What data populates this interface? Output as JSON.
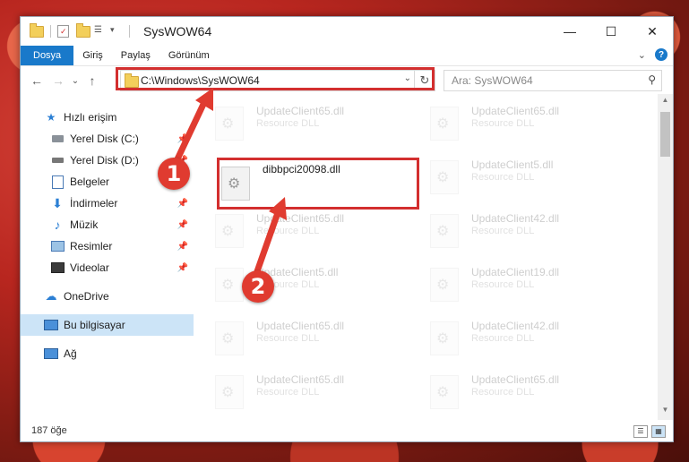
{
  "window": {
    "title": "SysWOW64"
  },
  "window_controls": {
    "minimize": "—",
    "maximize": "☐",
    "close": "✕"
  },
  "ribbon": {
    "tabs": [
      "Dosya",
      "Giriş",
      "Paylaş",
      "Görünüm"
    ],
    "expand": "⌄",
    "help": "?"
  },
  "nav": {
    "back": "←",
    "forward": "→",
    "recent": "⌄",
    "up": "↑",
    "address": "C:\\Windows\\SysWOW64",
    "address_dropdown": "⌄",
    "refresh": "↻",
    "search_placeholder": "Ara: SysWOW64",
    "search_icon": "⚲"
  },
  "sidebar": {
    "items": [
      {
        "label": "Hızlı erişim",
        "icon": "star-icon"
      },
      {
        "label": "Yerel Disk (C:)",
        "icon": "drive-icon"
      },
      {
        "label": "Yerel Disk (D:)",
        "icon": "drive-icon"
      },
      {
        "label": "Belgeler",
        "icon": "documents-icon"
      },
      {
        "label": "İndirmeler",
        "icon": "download-icon"
      },
      {
        "label": "Müzik",
        "icon": "music-icon"
      },
      {
        "label": "Resimler",
        "icon": "pictures-icon"
      },
      {
        "label": "Videolar",
        "icon": "video-icon"
      },
      {
        "label": "OneDrive",
        "icon": "cloud-icon"
      },
      {
        "label": "Bu bilgisayar",
        "icon": "computer-icon"
      },
      {
        "label": "Ağ",
        "icon": "network-icon"
      }
    ]
  },
  "files": {
    "highlighted": {
      "name": "dibbpci20098.dll"
    },
    "background": [
      {
        "name": "UpdateClient65.dll",
        "desc": "Resource DLL"
      },
      {
        "name": "UpdateClient65.dll",
        "desc": "Resource DLL"
      },
      {
        "name": "UpdateClient5.dll",
        "desc": "Resource DLL"
      },
      {
        "name": "UpdateClient65.dll",
        "desc": "Resource DLL"
      },
      {
        "name": "UpdateClient42.dll",
        "desc": "Resource DLL"
      },
      {
        "name": "UpdateClient5.dll",
        "desc": "Resource DLL"
      },
      {
        "name": "UpdateClient19.dll",
        "desc": "Resource DLL"
      },
      {
        "name": "UpdateClient65.dll",
        "desc": "Resource DLL"
      },
      {
        "name": "UpdateClient42.dll",
        "desc": "Resource DLL"
      },
      {
        "name": "UpdateClient65.dll",
        "desc": "Resource DLL"
      },
      {
        "name": "UpdateClient65.dll",
        "desc": "Resource DLL"
      }
    ]
  },
  "status": {
    "count": "187 öğe"
  },
  "annotations": {
    "step1": "1",
    "step2": "2"
  },
  "colors": {
    "highlight": "#d32f2f",
    "accent": "#1979ca"
  }
}
